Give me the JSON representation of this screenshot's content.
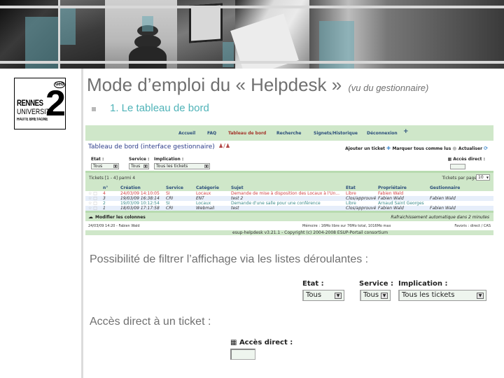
{
  "slide": {
    "title": "Mode d’emploi du « Helpdesk »",
    "title_suffix": "(vu du gestionnaire)",
    "subtitle": "1. Le tableau de bord",
    "paragraph_filters": "Possibilité de filtrer l’affichage via les listes déroulantes :",
    "paragraph_direct": "Accès direct à un ticket :",
    "accent_color": "#4fb3b8"
  },
  "logo": {
    "badge": "ueb",
    "line1": "RENNES",
    "line2": "UNIVERSITE",
    "line3": "HAUTE BRETAGNE",
    "numeral": "2"
  },
  "helpdesk": {
    "nav": [
      "Accueil",
      "FAQ",
      "Tableau de bord",
      "Recherche",
      "Signets/Historique",
      "Déconnexion",
      "+"
    ],
    "active_nav": "Tableau de bord",
    "page_title": "Tableau de bord (interface gestionnaire)",
    "users_icon": "user-swap-icon",
    "actions": {
      "add_ticket": "Ajouter un ticket",
      "mark_read": "Marquer tous comme lus",
      "refresh": "Actualiser"
    },
    "filters": {
      "etat_label": "Etat :",
      "etat_value": "Tous",
      "service_label": "Service :",
      "service_value": "Tous",
      "implication_label": "Implication :",
      "implication_value": "Tous les tickets"
    },
    "direct_access_label": "Accès direct :",
    "ticket_count": "Tickets [1 - 4] parmi 4",
    "per_page_label": "Tickets par page :",
    "per_page_value": "10",
    "columns": [
      "n°",
      "Création",
      "Service",
      "Catégorie",
      "Sujet",
      "Etat",
      "Propriétaire",
      "Gestionnaire"
    ],
    "rows": [
      {
        "num": "4",
        "created": "24/03/09 14:10:05",
        "service": "SI",
        "category": "Locaux",
        "subject": "Demande de mise à disposition des Locaux à l'Un...",
        "state": "Libre",
        "owner": "Fabien Wald",
        "manager": ""
      },
      {
        "num": "3",
        "created": "19/03/09 16:38:14",
        "service": "CRI",
        "category": "ENT",
        "subject": "test 2",
        "state": "Clos/approuvé",
        "owner": "Fabien Wald",
        "manager": "Fabien Wald"
      },
      {
        "num": "2",
        "created": "19/03/09 10:12:54",
        "service": "SI",
        "category": "Locaux",
        "subject": "Demande d'une salle pour une conférence",
        "state": "Libre",
        "owner": "Arnaud Saint Georges",
        "manager": ""
      },
      {
        "num": "1",
        "created": "18/03/09 17:17:58",
        "service": "CRI",
        "category": "Webmail",
        "subject": "test",
        "state": "Clos/approuvé",
        "owner": "Fabien Wald",
        "manager": "Fabien Wald"
      }
    ],
    "modify_columns": "Modifier les colonnes",
    "auto_refresh": "Rafraichissement automatique dans 2 minutes",
    "footer_user": "24/03/09 14:20 - Fabien Wald",
    "footer_memory": "Mémoire : 16Mo libre sur 76Mo total, 1016Mo max",
    "footer_favs": "Favoris : direct / CAS",
    "copyright": "esup-helpdesk v3.21.1 - Copyright (c) 2004-2008 ESUP-Portail consortium"
  },
  "zoomed_filters": {
    "etat_label": "Etat :",
    "etat_value": "Tous",
    "service_label": "Service :",
    "service_value": "Tous",
    "implication_label": "Implication :",
    "implication_value": "Tous les tickets"
  },
  "zoomed_direct": {
    "label": "Accès direct :",
    "value": ""
  }
}
